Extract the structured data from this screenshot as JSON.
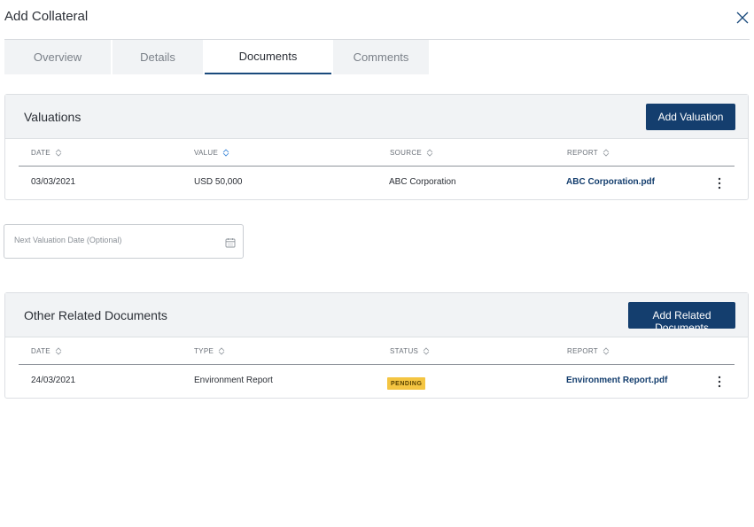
{
  "header": {
    "title": "Add Collateral"
  },
  "tabs": [
    {
      "label": "Overview"
    },
    {
      "label": "Details"
    },
    {
      "label": "Documents"
    },
    {
      "label": "Comments"
    }
  ],
  "valuations": {
    "title": "Valuations",
    "add_button": "Add Valuation",
    "columns": [
      "DATE",
      "VALUE",
      "SOURCE",
      "REPORT"
    ],
    "rows": [
      {
        "date": "03/03/2021",
        "value": "USD  50,000",
        "source": "ABC Corporation",
        "report": "ABC Corporation.pdf"
      }
    ]
  },
  "next_valuation": {
    "placeholder": "Next Valuation Date (Optional)"
  },
  "related": {
    "title": "Other Related Documents",
    "add_button": "Add Related Documents",
    "columns": [
      "DATE",
      "TYPE",
      "STATUS",
      "REPORT"
    ],
    "rows": [
      {
        "date": "24/03/2021",
        "type": "Environment Report",
        "status": "PENDING",
        "report": "Environment Report.pdf"
      }
    ]
  },
  "colors": {
    "primary": "#143e6e",
    "pending_badge": "#f4c542",
    "panel_header": "#f1f3f5",
    "tab_underline": "#1a4a7c"
  }
}
